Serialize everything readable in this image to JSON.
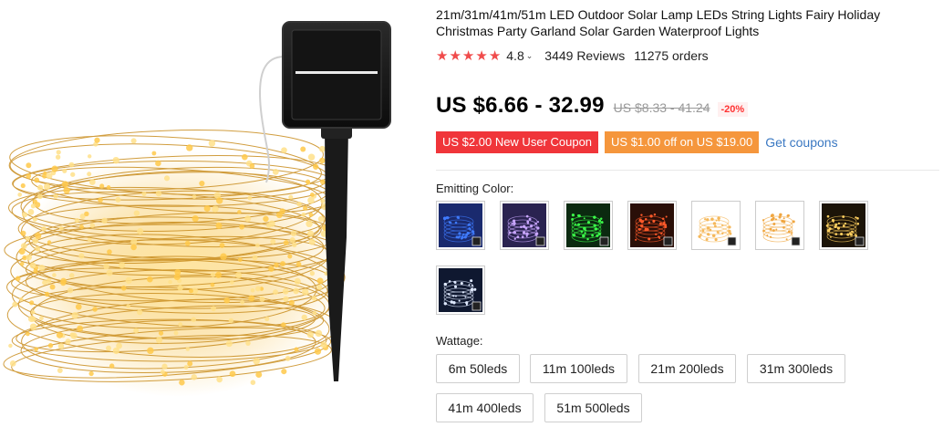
{
  "product": {
    "title": "21m/31m/41m/51m LED Outdoor Solar Lamp LEDs String Lights Fairy Holiday Christmas Party Garland Solar Garden Waterproof Lights",
    "stars": 5,
    "star_glyph": "★",
    "rating": "4.8",
    "rating_caret": "⌄",
    "reviews": "3449 Reviews",
    "orders": "11275 orders"
  },
  "price": {
    "current": "US $6.66 - 32.99",
    "original": "US $8.33 - 41.24",
    "discount": "-20%"
  },
  "coupons": {
    "new_user": "US $2.00 New User Coupon",
    "off": "US $1.00 off on US $19.00",
    "get_link": "Get coupons",
    "colors": {
      "red": "#f0353a",
      "orange": "#f5963c",
      "link": "#3a78c2"
    }
  },
  "emitting_color": {
    "label": "Emitting Color:",
    "options": [
      {
        "icon": "blue-lights-thumbnail",
        "bg": "#1a2a6e",
        "glow": "#3f7bff"
      },
      {
        "icon": "multicolor-lights-thumbnail",
        "bg": "#2a2350",
        "glow": "#c9a6ff"
      },
      {
        "icon": "green-lights-thumbnail",
        "bg": "#0b2a10",
        "glow": "#3cff4a"
      },
      {
        "icon": "red-lights-thumbnail",
        "bg": "#2a0f08",
        "glow": "#ff5a2a"
      },
      {
        "icon": "warm-white-cold-white-thumbnail",
        "bg": "#ffffff",
        "glow": "#f5b85a"
      },
      {
        "icon": "warm-white-solar-thumbnail",
        "bg": "#ffffff",
        "glow": "#f0a640"
      },
      {
        "icon": "warm-white-dark-thumbnail",
        "bg": "#1c1408",
        "glow": "#ffd060"
      },
      {
        "icon": "cold-white-lights-thumbnail",
        "bg": "#0f1830",
        "glow": "#dfe9ff"
      }
    ]
  },
  "wattage": {
    "label": "Wattage:",
    "options": [
      "6m 50leds",
      "11m 100leds",
      "21m 200leds",
      "31m 300leds",
      "41m 400leds",
      "51m 500leds"
    ]
  }
}
